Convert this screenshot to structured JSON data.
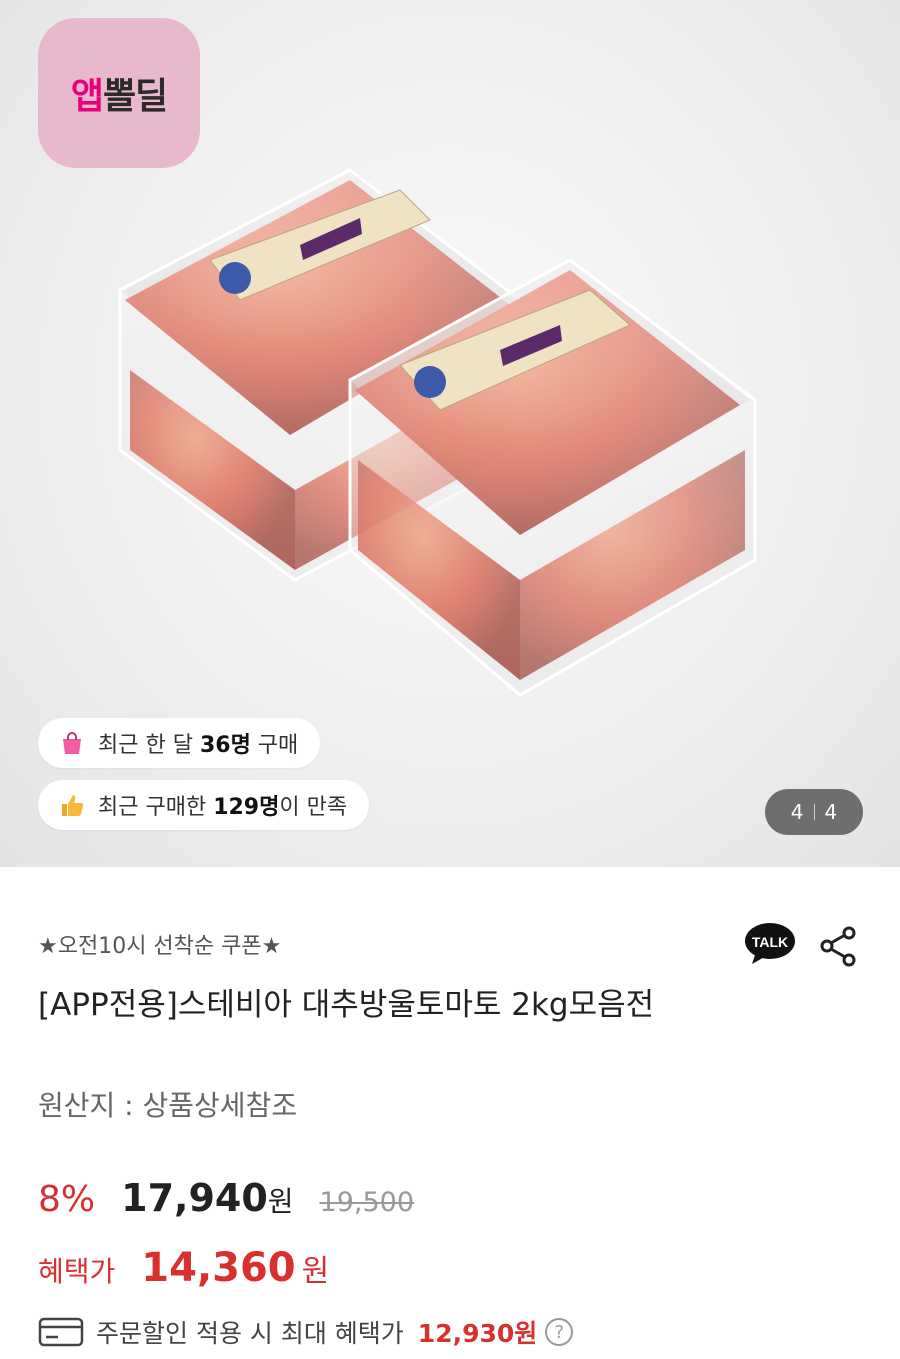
{
  "app_logo": {
    "text_a": "앱",
    "text_b": "뽈딜"
  },
  "hero": {
    "recent_month": {
      "prefix": "최근 한 달 ",
      "count": "36명",
      "suffix": " 구매"
    },
    "recent_satisfied": {
      "prefix": "최근 구매한 ",
      "count": "129명",
      "suffix": "이 만족"
    },
    "counter": {
      "current": "4",
      "total": "4"
    }
  },
  "product": {
    "promo": "★오전10시 선착순 쿠폰★",
    "title": "[APP전용]스테비아 대추방울토마토 2kg모음전",
    "origin": "원산지 : 상품상세참조",
    "share_talk_label": "TALK",
    "price": {
      "discount": "8%",
      "current": "17,940",
      "currency": "원",
      "original": "19,500"
    },
    "benefit": {
      "label": "혜택가",
      "price": "14,360",
      "currency": "원"
    },
    "max_benefit": {
      "text": "주문할인 적용 시 최대 혜택가",
      "price": "12,930원",
      "help": "?"
    }
  },
  "colors": {
    "accent_red": "#d8302f",
    "logo_pink": "#e6007e",
    "logo_bg": "#e8b9cc"
  }
}
